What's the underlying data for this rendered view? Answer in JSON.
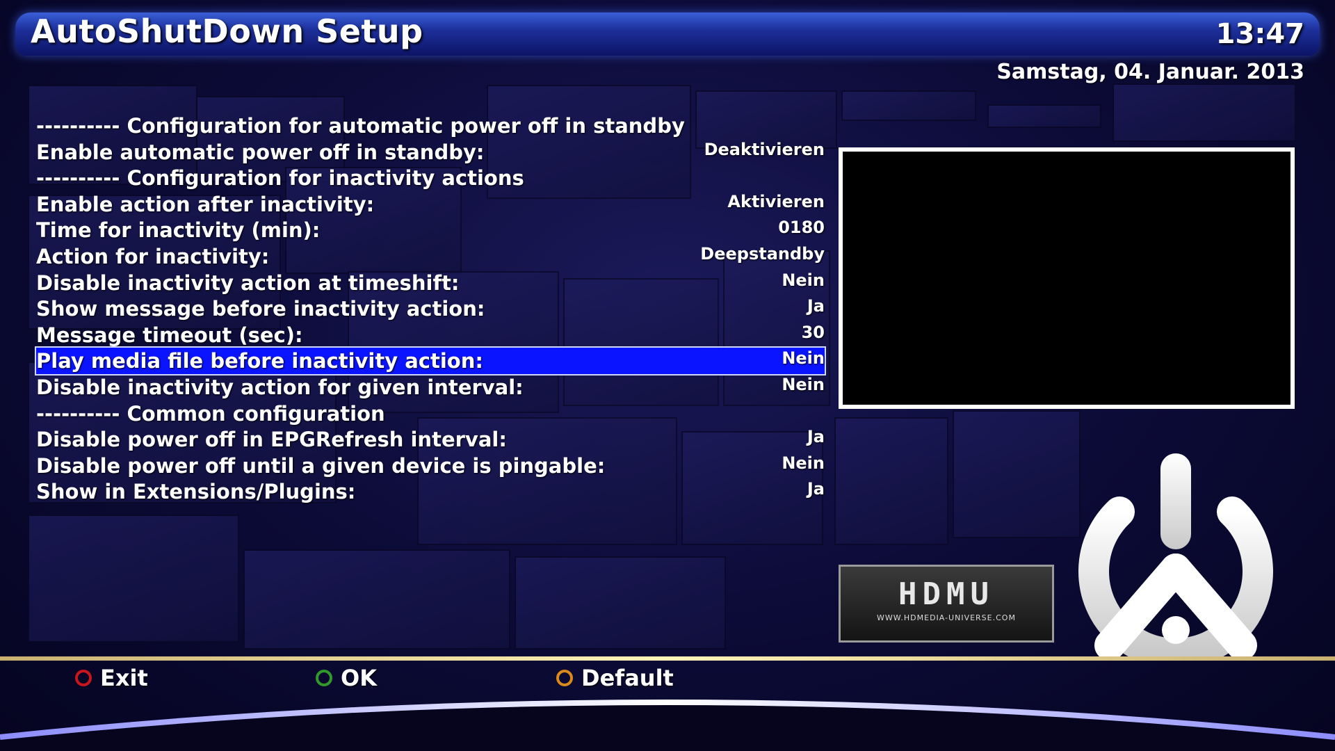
{
  "header": {
    "title": "AutoShutDown Setup",
    "time": "13:47",
    "date": "Samstag, 04. Januar. 2013"
  },
  "config": {
    "rows": [
      {
        "label": "---------- Configuration for automatic power off in standby",
        "value": ""
      },
      {
        "label": "Enable automatic power off in standby:",
        "value": "Deaktivieren"
      },
      {
        "label": "---------- Configuration for inactivity actions",
        "value": ""
      },
      {
        "label": "Enable action after inactivity:",
        "value": "Aktivieren"
      },
      {
        "label": "Time for inactivity (min):",
        "value": "0180"
      },
      {
        "label": "Action for inactivity:",
        "value": "Deepstandby"
      },
      {
        "label": "Disable inactivity action at timeshift:",
        "value": "Nein"
      },
      {
        "label": "Show message before inactivity action:",
        "value": "Ja"
      },
      {
        "label": "Message timeout (sec):",
        "value": "30"
      },
      {
        "label": "Play media file before inactivity action:",
        "value": "Nein"
      },
      {
        "label": "Disable inactivity action for given interval:",
        "value": "Nein"
      },
      {
        "label": "---------- Common configuration",
        "value": ""
      },
      {
        "label": "Disable power off in EPGRefresh interval:",
        "value": "Ja"
      },
      {
        "label": "Disable power off until a given device is pingable:",
        "value": "Nein"
      },
      {
        "label": "Show in Extensions/Plugins:",
        "value": "Ja"
      }
    ],
    "selected_index": 9
  },
  "logo": {
    "text": "HDMU",
    "url": "WWW.HDMEDIA-UNIVERSE.COM"
  },
  "buttons": {
    "exit": {
      "label": "Exit",
      "color": "#c8161c"
    },
    "ok": {
      "label": "OK",
      "color": "#2f9a2a"
    },
    "default": {
      "label": "Default",
      "color": "#d98a1a"
    }
  },
  "colors": {
    "selection": "#0b14ff",
    "header": "#1d2f9a"
  }
}
